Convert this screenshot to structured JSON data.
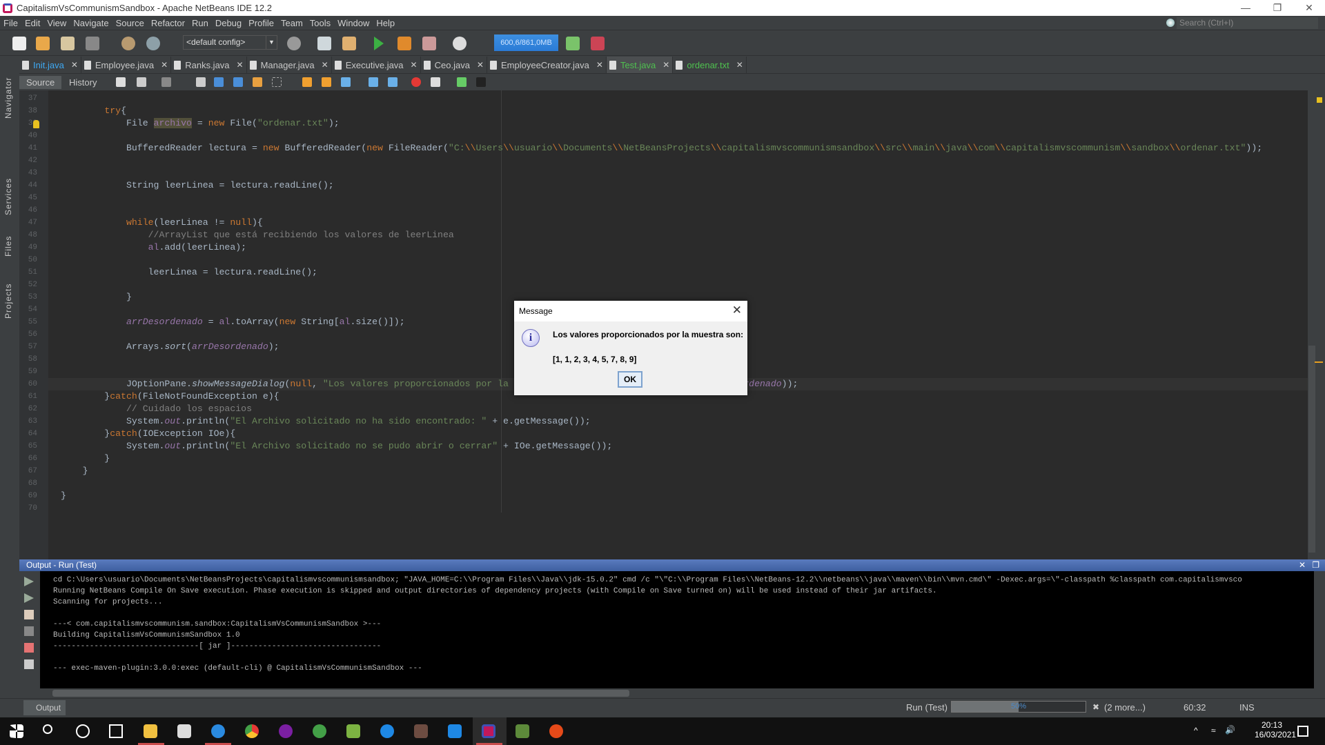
{
  "window": {
    "title": "CapitalismVsCommunismSandbox - Apache NetBeans IDE 12.2"
  },
  "menu": [
    "File",
    "Edit",
    "View",
    "Navigate",
    "Source",
    "Refactor",
    "Run",
    "Debug",
    "Profile",
    "Team",
    "Tools",
    "Window",
    "Help"
  ],
  "search": {
    "placeholder": "Search (Ctrl+I)"
  },
  "toolbar": {
    "config": "<default config>",
    "memory": "600,6/861,0MB"
  },
  "tabs": [
    {
      "label": "Init.java",
      "color": "#3ea8f2"
    },
    {
      "label": "Employee.java",
      "color": "#c8c8c8"
    },
    {
      "label": "Ranks.java",
      "color": "#c8c8c8"
    },
    {
      "label": "Manager.java",
      "color": "#c8c8c8"
    },
    {
      "label": "Executive.java",
      "color": "#c8c8c8"
    },
    {
      "label": "Ceo.java",
      "color": "#c8c8c8"
    },
    {
      "label": "EmployeeCreator.java",
      "color": "#c8c8c8"
    },
    {
      "label": "Test.java",
      "color": "#4fc14f",
      "active": true
    },
    {
      "label": "ordenar.txt",
      "color": "#4fc14f"
    }
  ],
  "editor_tabs": {
    "source": "Source",
    "history": "History"
  },
  "side_panels": [
    "Navigator",
    "Services",
    "Files",
    "Projects"
  ],
  "code": [
    {
      "n": "37",
      "t": []
    },
    {
      "n": "38",
      "t": [
        [
          "",
          "        "
        ],
        [
          "kw",
          "try"
        ],
        [
          "",
          "{"
        ]
      ]
    },
    {
      "n": "39",
      "t": [
        [
          "",
          "            File "
        ],
        [
          "hl fld",
          "archivo"
        ],
        [
          "",
          " = "
        ],
        [
          "kw",
          "new"
        ],
        [
          "",
          " File("
        ],
        [
          "str",
          "\"ordenar.txt\""
        ],
        [
          "",
          ");"
        ]
      ]
    },
    {
      "n": "40",
      "t": []
    },
    {
      "n": "41",
      "t": [
        [
          "",
          "            BufferedReader lectura = "
        ],
        [
          "kw",
          "new"
        ],
        [
          "",
          " BufferedReader("
        ],
        [
          "kw",
          "new"
        ],
        [
          "",
          " FileReader("
        ],
        [
          "str",
          "\"C:"
        ],
        [
          "esc",
          "\\\\"
        ],
        [
          "str",
          "Users"
        ],
        [
          "esc",
          "\\\\"
        ],
        [
          "str",
          "usuario"
        ],
        [
          "esc",
          "\\\\"
        ],
        [
          "str",
          "Documents"
        ],
        [
          "esc",
          "\\\\"
        ],
        [
          "str",
          "NetBeansProjects"
        ],
        [
          "esc",
          "\\\\"
        ],
        [
          "str",
          "capitalismvscommunismsandbox"
        ],
        [
          "esc",
          "\\\\"
        ],
        [
          "str",
          "src"
        ],
        [
          "esc",
          "\\\\"
        ],
        [
          "str",
          "main"
        ],
        [
          "esc",
          "\\\\"
        ],
        [
          "str",
          "java"
        ],
        [
          "esc",
          "\\\\"
        ],
        [
          "str",
          "com"
        ],
        [
          "esc",
          "\\\\"
        ],
        [
          "str",
          "capitalismvscommunism"
        ],
        [
          "esc",
          "\\\\"
        ],
        [
          "str",
          "sandbox"
        ],
        [
          "esc",
          "\\\\"
        ],
        [
          "str",
          "ordenar.txt\""
        ],
        [
          "",
          "));"
        ]
      ]
    },
    {
      "n": "42",
      "t": []
    },
    {
      "n": "43",
      "t": []
    },
    {
      "n": "44",
      "t": [
        [
          "",
          "            String leerLinea = lectura.readLine();"
        ]
      ]
    },
    {
      "n": "45",
      "t": []
    },
    {
      "n": "46",
      "t": []
    },
    {
      "n": "47",
      "t": [
        [
          "",
          "            "
        ],
        [
          "kw",
          "while"
        ],
        [
          "",
          "(leerLinea != "
        ],
        [
          "kw",
          "null"
        ],
        [
          "",
          "){"
        ]
      ]
    },
    {
      "n": "48",
      "t": [
        [
          "",
          "                "
        ],
        [
          "com",
          "//ArrayList que está recibiendo los valores de leerLinea"
        ]
      ]
    },
    {
      "n": "49",
      "t": [
        [
          "",
          "                "
        ],
        [
          "fld",
          "al"
        ],
        [
          "",
          ".add(leerLinea);"
        ]
      ]
    },
    {
      "n": "50",
      "t": []
    },
    {
      "n": "51",
      "t": [
        [
          "",
          "                leerLinea = lectura.readLine();"
        ]
      ]
    },
    {
      "n": "52",
      "t": []
    },
    {
      "n": "53",
      "t": [
        [
          "",
          "            }"
        ]
      ]
    },
    {
      "n": "54",
      "t": []
    },
    {
      "n": "55",
      "t": [
        [
          "",
          "            "
        ],
        [
          "fldit",
          "arrDesordenado"
        ],
        [
          "",
          " = "
        ],
        [
          "fld",
          "al"
        ],
        [
          "",
          ".toArray("
        ],
        [
          "kw",
          "new"
        ],
        [
          "",
          " String["
        ],
        [
          "fld",
          "al"
        ],
        [
          "",
          ".size()]);"
        ]
      ]
    },
    {
      "n": "56",
      "t": []
    },
    {
      "n": "57",
      "t": [
        [
          "",
          "            Arrays."
        ],
        [
          "it",
          "sort"
        ],
        [
          "",
          "("
        ],
        [
          "fldit",
          "arrDesordenado"
        ],
        [
          "",
          ");"
        ]
      ]
    },
    {
      "n": "58",
      "t": []
    },
    {
      "n": "59",
      "t": []
    },
    {
      "n": "60",
      "t": [
        [
          "",
          "            JOptionPane."
        ],
        [
          "it",
          "showMessageDialog"
        ],
        [
          "",
          "("
        ],
        [
          "kw",
          "null"
        ],
        [
          "",
          ", "
        ],
        [
          "str",
          "\"Los valores proporcionados por la"
        ],
        [
          "",
          "                                          "
        ],
        [
          "fldit",
          "ordenado"
        ],
        [
          "",
          "));"
        ]
      ]
    },
    {
      "n": "61",
      "t": [
        [
          "",
          "        }"
        ],
        [
          "kw",
          "catch"
        ],
        [
          "",
          "(FileNotFoundException e){"
        ]
      ]
    },
    {
      "n": "62",
      "t": [
        [
          "",
          "            "
        ],
        [
          "com",
          "// Cuidado los espacios"
        ]
      ]
    },
    {
      "n": "63",
      "t": [
        [
          "",
          "            System."
        ],
        [
          "fldit",
          "out"
        ],
        [
          "",
          ".println("
        ],
        [
          "str",
          "\"El Archivo solicitado no ha sido encontrado: \""
        ],
        [
          "",
          " + e.getMessage());"
        ]
      ]
    },
    {
      "n": "64",
      "t": [
        [
          "",
          "        }"
        ],
        [
          "kw",
          "catch"
        ],
        [
          "",
          "(IOException IOe){"
        ]
      ]
    },
    {
      "n": "65",
      "t": [
        [
          "",
          "            System."
        ],
        [
          "fldit",
          "out"
        ],
        [
          "",
          ".println("
        ],
        [
          "str",
          "\"El Archivo solicitado no se pudo abrir o cerrar\""
        ],
        [
          "",
          " + IOe.getMessage());"
        ]
      ]
    },
    {
      "n": "66",
      "t": [
        [
          "",
          "        }"
        ]
      ]
    },
    {
      "n": "67",
      "t": [
        [
          "",
          "    }"
        ]
      ]
    },
    {
      "n": "68",
      "t": []
    },
    {
      "n": "69",
      "t": [
        [
          "",
          "}"
        ]
      ]
    },
    {
      "n": "70",
      "t": []
    }
  ],
  "dialog": {
    "title": "Message",
    "message": "Los valores proporcionados por la muestra son:",
    "values": "[1, 1, 2, 3, 4, 5, 7, 8, 9]",
    "ok": "OK"
  },
  "output": {
    "title": "Output - Run (Test)",
    "lines": [
      "cd C:\\Users\\usuario\\Documents\\NetBeansProjects\\capitalismvscommunismsandbox; \"JAVA_HOME=C:\\\\Program Files\\\\Java\\\\jdk-15.0.2\" cmd /c \"\\\"C:\\\\Program Files\\\\NetBeans-12.2\\\\netbeans\\\\java\\\\maven\\\\bin\\\\mvn.cmd\\\" -Dexec.args=\\\"-classpath %classpath com.capitalismvsco",
      "Running NetBeans Compile On Save execution. Phase execution is skipped and output directories of dependency projects (with Compile on Save turned on) will be used instead of their jar artifacts.",
      "Scanning for projects...",
      "",
      "---< com.capitalismvscommunism.sandbox:CapitalismVsCommunismSandbox >---",
      "Building CapitalismVsCommunismSandbox 1.0",
      "--------------------------------[ jar ]---------------------------------",
      "",
      "--- exec-maven-plugin:3.0.0:exec (default-cli) @ CapitalismVsCommunismSandbox ---"
    ]
  },
  "status": {
    "output_tab": "Output",
    "task": "Run (Test)",
    "progress_percent": 50,
    "progress_label": "50%",
    "more": "(2 more...)",
    "position": "60:32",
    "mode": "INS"
  },
  "taskbar": {
    "time": "20:13",
    "date": "16/03/2021"
  }
}
